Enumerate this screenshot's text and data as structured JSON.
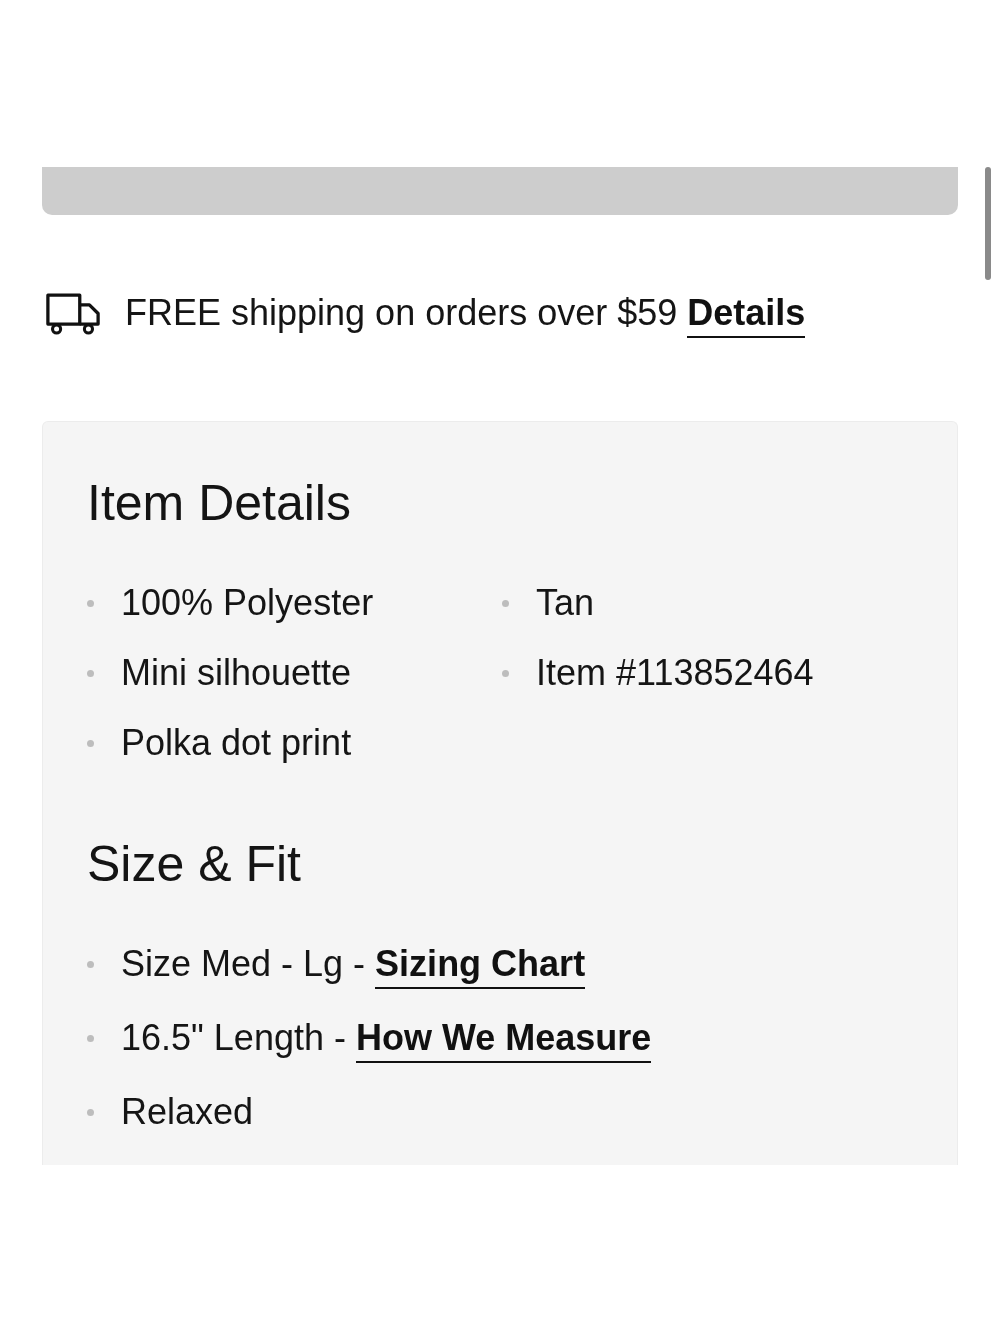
{
  "button": {
    "disabled": true
  },
  "shipping": {
    "text": "FREE shipping on orders over $59",
    "link": "Details"
  },
  "sections": [
    {
      "title": "Item Details",
      "columns": [
        {
          "items": [
            {
              "text": "100% Polyester"
            },
            {
              "text": "Mini silhouette"
            },
            {
              "text": "Polka dot print"
            }
          ]
        },
        {
          "items": [
            {
              "text": "Tan"
            },
            {
              "text": "Item #113852464"
            }
          ]
        }
      ]
    },
    {
      "title": "Size & Fit",
      "columns": [
        {
          "items": [
            {
              "text": "Size Med - Lg -",
              "link": "Sizing Chart"
            },
            {
              "text": "16.5\" Length -",
              "link": "How We Measure"
            },
            {
              "text": "Relaxed"
            }
          ]
        }
      ]
    }
  ]
}
